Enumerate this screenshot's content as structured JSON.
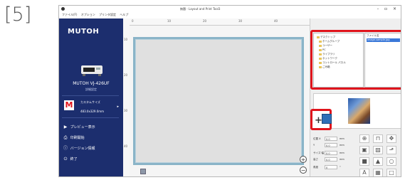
{
  "step_label": "[5]",
  "window": {
    "title": "無題 - Layout and Print Tool3",
    "controls": "-  ▫  ×"
  },
  "menu": [
    "ファイル(F)",
    "オプション",
    "プリンタ設定",
    "ヘルプ"
  ],
  "sidebar": {
    "logo": "MUTOH",
    "printer_name": "MUTOH VJ-426UF",
    "printer_status": "詳細設定",
    "media_type": "カスタムサイズ",
    "media_size": "483.0x329.0mm",
    "nav": [
      {
        "icon": "▶",
        "label": "プレビュー表示"
      },
      {
        "icon": "⎙",
        "label": "印刷開始"
      },
      {
        "icon": "ⓘ",
        "label": "バージョン情報"
      },
      {
        "icon": "⏻",
        "label": "終了"
      }
    ]
  },
  "ruler_ticks": [
    "0",
    "10",
    "20",
    "30",
    "40"
  ],
  "file_browser": {
    "tree": [
      "デスクトップ",
      "ホームグループ",
      "ユーザー",
      "PC",
      "ライブラリ",
      "ネットワーク",
      "コントロール パネル",
      "ごみ箱"
    ],
    "file_header": "ファイル名",
    "selected_file": "image-sample.jpg"
  },
  "properties": [
    {
      "label": "位置 X",
      "value": "0.0",
      "unit": "mm"
    },
    {
      "label": "Y",
      "value": "0.0",
      "unit": "mm"
    },
    {
      "label": "サイズ 幅",
      "value": "0.0",
      "unit": "mm"
    },
    {
      "label": "高さ",
      "value": "0.0",
      "unit": "mm"
    },
    {
      "label": "角度",
      "value": "0",
      "unit": "°"
    }
  ],
  "colors": {
    "sidebar": "#1c2e6e",
    "highlight": "#e0141c",
    "canvas_border": "#8ab4c8"
  }
}
